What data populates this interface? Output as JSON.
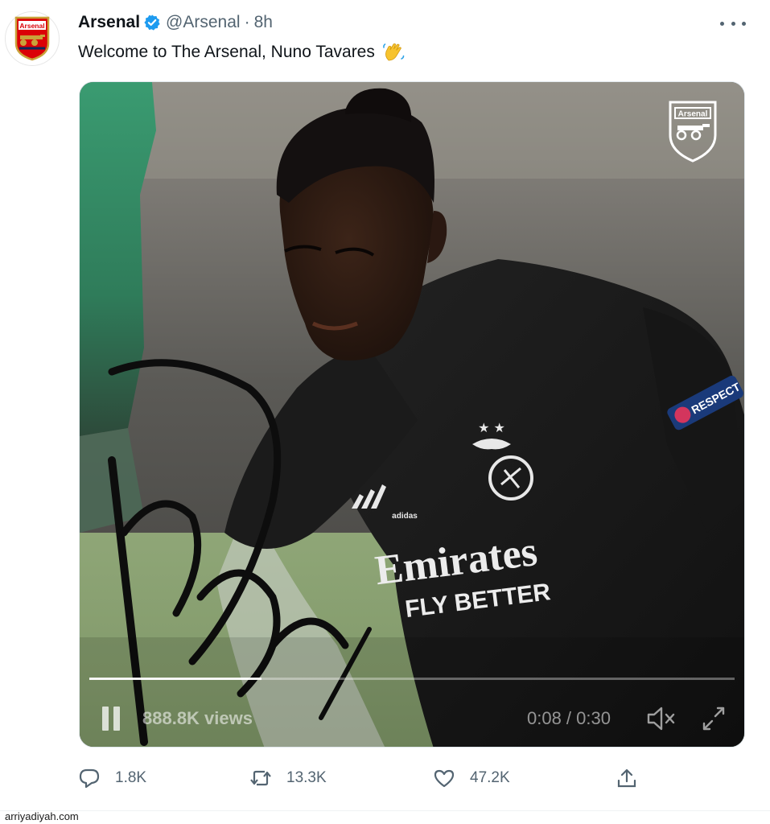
{
  "tweet": {
    "author_name": "Arsenal",
    "handle": "@Arsenal",
    "separator": "·",
    "time": "8h",
    "text": "Welcome to The Arsenal, Nuno Tavares",
    "verified": true,
    "more_icon": "more-horizontal-icon"
  },
  "media": {
    "views": "888.8K views",
    "time_display": "0:08 / 0:30",
    "progress": 0.2667,
    "crest_label": "Arsenal",
    "jersey": {
      "sponsor_line1": "Emirates",
      "sponsor_line2": "FLY BETTER",
      "sleeve_badge": "RESPECT",
      "brand": "adidas"
    }
  },
  "actions": {
    "reply_count": "1.8K",
    "retweet_count": "13.3K",
    "like_count": "47.2K"
  },
  "watermark": "arriyadiyah.com",
  "colors": {
    "verified_blue": "#1d9bf0",
    "arsenal_red": "#db0007",
    "text_secondary": "#536471"
  }
}
